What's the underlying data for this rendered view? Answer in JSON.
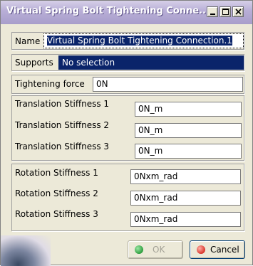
{
  "window": {
    "title": "Virtual Spring Bolt Tightening Conne...",
    "controls": {
      "minimize": "minimize-icon",
      "maximize": "maximize-icon",
      "close": "close-icon"
    }
  },
  "name": {
    "label": "Name",
    "value": "Virtual Spring Bolt Tightening Connection.1"
  },
  "supports": {
    "label": "Supports",
    "value": "No selection"
  },
  "tightening": {
    "label": "Tightening force",
    "value": "0N"
  },
  "translation": [
    {
      "label": "Translation Stiffness 1",
      "value": "0N_m"
    },
    {
      "label": "Translation Stiffness 2",
      "value": "0N_m"
    },
    {
      "label": "Translation Stiffness 3",
      "value": "0N_m"
    }
  ],
  "rotation": [
    {
      "label": "Rotation Stiffness 1",
      "value": "0Nxm_rad"
    },
    {
      "label": "Rotation Stiffness 2",
      "value": "0Nxm_rad"
    },
    {
      "label": "Rotation Stiffness 3",
      "value": "0Nxm_rad"
    }
  ],
  "buttons": {
    "ok": "OK",
    "cancel": "Cancel"
  },
  "colors": {
    "selection": "#0a246a",
    "ok_icon": "#2e9e3e",
    "cancel_icon": "#d9362c"
  }
}
